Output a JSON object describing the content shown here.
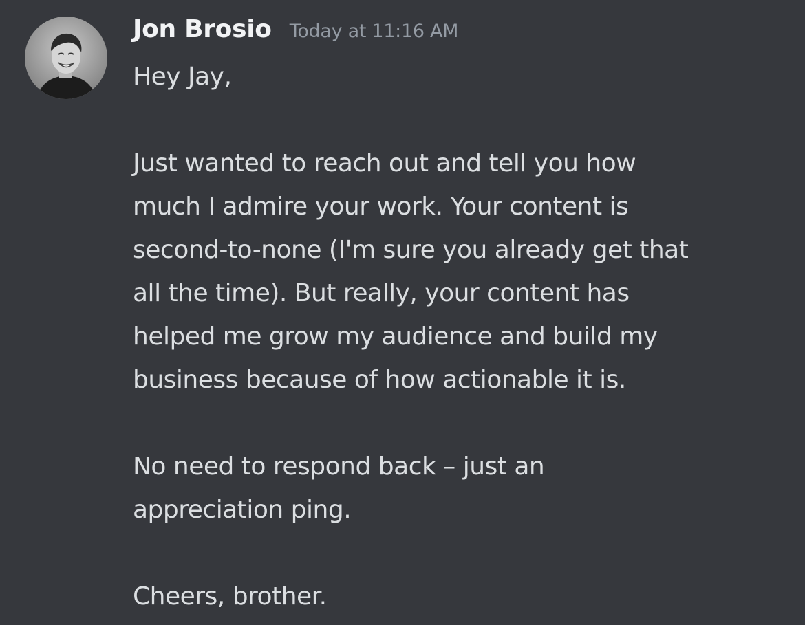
{
  "message": {
    "author": "Jon Brosio",
    "timestamp": "Today at 11:16 AM",
    "lines": [
      "Hey Jay,",
      "",
      "Just wanted to reach out and tell you how",
      "much I admire your work. Your content is",
      "second-to-none (I'm sure you already get that",
      "all the time). But really, your content has",
      "helped me grow my audience and build my",
      "business because of how actionable it is.",
      "",
      "No need to respond back – just an",
      "appreciation ping.",
      "",
      "Cheers, brother."
    ]
  },
  "colors": {
    "background": "#36383d",
    "username": "#f2f3f5",
    "timestamp": "#949ba4",
    "text": "#dbdee1"
  }
}
